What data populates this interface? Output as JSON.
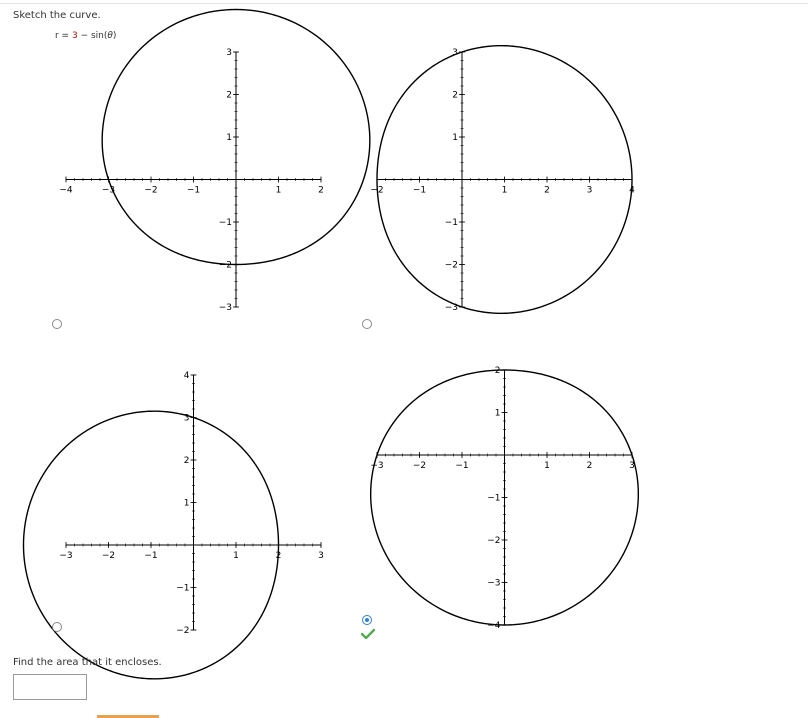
{
  "question": {
    "instruction": "Sketch the curve.",
    "equation": {
      "lhs": "r = ",
      "constant": "3",
      "rest": " − sin(",
      "theta": "θ",
      "close": ")"
    },
    "colors": {
      "constant": "#cc0000",
      "curve": "#000000",
      "selected": "#2d7fd8",
      "correct": "#4cae4c"
    }
  },
  "options": [
    {
      "id": "A",
      "selected": false,
      "chart_data": {
        "type": "line",
        "title": "",
        "xlabel": "",
        "ylabel": "",
        "equation": "r = 3 + sin(theta)",
        "shape": "circle-like polar curve",
        "xlim": [
          -4,
          2
        ],
        "ylim": [
          -3,
          3
        ],
        "x_ticks": [
          "-4",
          "-3",
          "-2",
          "-1",
          "1",
          "2"
        ],
        "y_ticks": [
          "3",
          "2",
          "1",
          "-1",
          "-2",
          "-3"
        ]
      }
    },
    {
      "id": "B",
      "selected": false,
      "chart_data": {
        "type": "line",
        "title": "",
        "xlabel": "",
        "ylabel": "",
        "equation": "r = 3 + cos(theta)",
        "shape": "circle-like polar curve",
        "xlim": [
          -2,
          4
        ],
        "ylim": [
          -3,
          3
        ],
        "x_ticks": [
          "-2",
          "-1",
          "1",
          "2",
          "3",
          "4"
        ],
        "y_ticks": [
          "3",
          "2",
          "1",
          "-1",
          "-2",
          "-3"
        ]
      }
    },
    {
      "id": "C",
      "selected": false,
      "chart_data": {
        "type": "line",
        "title": "",
        "xlabel": "",
        "ylabel": "",
        "equation": "r = 3 - cos(theta)",
        "shape": "circle-like polar curve",
        "xlim": [
          -3,
          3
        ],
        "ylim": [
          -2,
          4
        ],
        "x_ticks": [
          "-3",
          "-2",
          "-1",
          "1",
          "2",
          "3"
        ],
        "y_ticks": [
          "4",
          "3",
          "2",
          "1",
          "-1",
          "-2"
        ]
      }
    },
    {
      "id": "D",
      "selected": true,
      "correct": true,
      "chart_data": {
        "type": "line",
        "title": "",
        "xlabel": "",
        "ylabel": "",
        "equation": "r = 3 - sin(theta)",
        "shape": "circle-like polar curve",
        "xlim": [
          -3,
          3
        ],
        "ylim": [
          -4,
          2
        ],
        "x_ticks": [
          "-3",
          "-2",
          "-1",
          "1",
          "2",
          "3"
        ],
        "y_ticks": [
          "2",
          "1",
          "-1",
          "-2",
          "-3",
          "-4"
        ]
      }
    }
  ],
  "area": {
    "label": "Find the area that it encloses.",
    "input_value": "",
    "placeholder": ""
  },
  "icons": {
    "check": "check-icon",
    "radio": "radio-icon"
  }
}
